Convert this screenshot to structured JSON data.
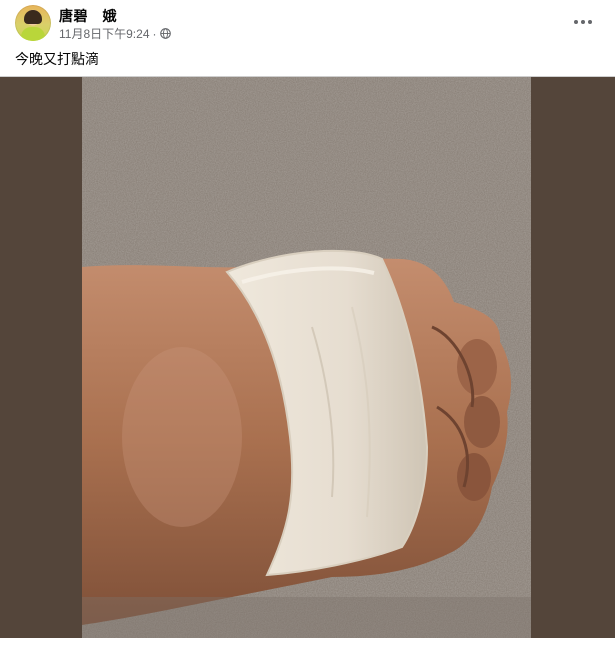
{
  "post": {
    "author": "唐碧　娥",
    "timestamp": "11月8日下午9:24",
    "separator": "·",
    "privacy_icon": "globe-icon",
    "more_icon": "more-horizontal-icon",
    "text": "今晚又打點滴"
  },
  "photo": {
    "subject": "wrist-with-bandage-photo",
    "colors": {
      "side_bars": "#54453a",
      "carpet": "#8a8077",
      "skin": "#b77a5e",
      "bandage": "#ece5d8"
    }
  }
}
